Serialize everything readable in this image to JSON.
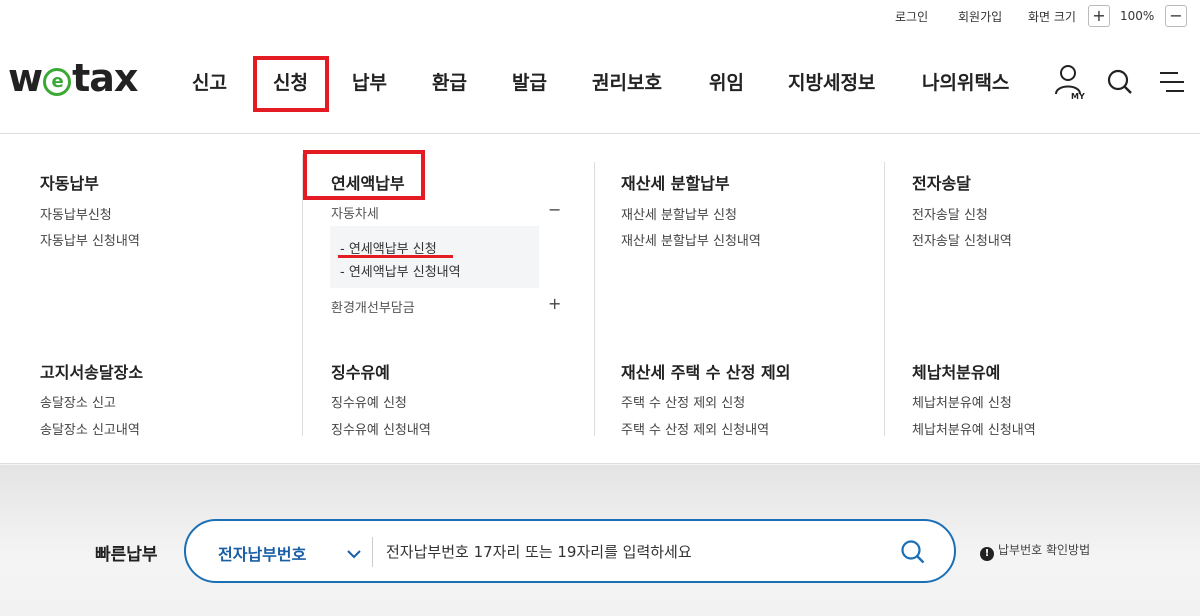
{
  "util": {
    "login": "로그인",
    "signup": "회원가입",
    "zoom_label": "화면 크기",
    "zoom_in": "+",
    "zoom_value": "100%",
    "zoom_out": "−"
  },
  "logo": {
    "text_pre": "w",
    "text_e": "e",
    "text_post": "tax"
  },
  "nav": {
    "items": [
      "신고",
      "신청",
      "납부",
      "환급",
      "발급",
      "권리보호",
      "위임",
      "지방세정보",
      "나의위택스"
    ]
  },
  "header_icons": {
    "my_label": "MY"
  },
  "mega": {
    "col1": {
      "title1": "자동납부",
      "links1": [
        "자동납부신청",
        "자동납부 신청내역"
      ],
      "title2": "고지서송달장소",
      "links2": [
        "송달장소 신고",
        "송달장소 신고내역"
      ]
    },
    "col2": {
      "title1": "연세액납부",
      "sub_auto": "자동차세",
      "sub_auto_toggle": "−",
      "sub_items": [
        "- 연세액납부 신청",
        "- 연세액납부 신청내역"
      ],
      "sub_env": "환경개선부담금",
      "sub_env_toggle": "+",
      "title2": "징수유예",
      "links2": [
        "징수유예 신청",
        "징수유예 신청내역"
      ]
    },
    "col3": {
      "title1": "재산세 분할납부",
      "links1": [
        "재산세 분할납부 신청",
        "재산세 분할납부 신청내역"
      ],
      "title2": "재산세 주택 수 산정 제외",
      "links2": [
        "주택 수 산정 제외 신청",
        "주택 수 산정 제외 신청내역"
      ]
    },
    "col4": {
      "title1": "전자송달",
      "links1": [
        "전자송달 신청",
        "전자송달 신청내역"
      ],
      "title2": "체납처분유예",
      "links2": [
        "체납처분유예 신청",
        "체납처분유예 신청내역"
      ]
    }
  },
  "fast_pay": {
    "label": "빠른납부",
    "select_value": "전자납부번호",
    "placeholder": "전자납부번호 17자리 또는 19자리를 입력하세요",
    "help_icon": "!",
    "help_text": "납부번호 확인방법"
  },
  "colors": {
    "accent_red": "#e31b23",
    "brand_blue": "#1a6fb5",
    "logo_green": "#3aa935"
  }
}
